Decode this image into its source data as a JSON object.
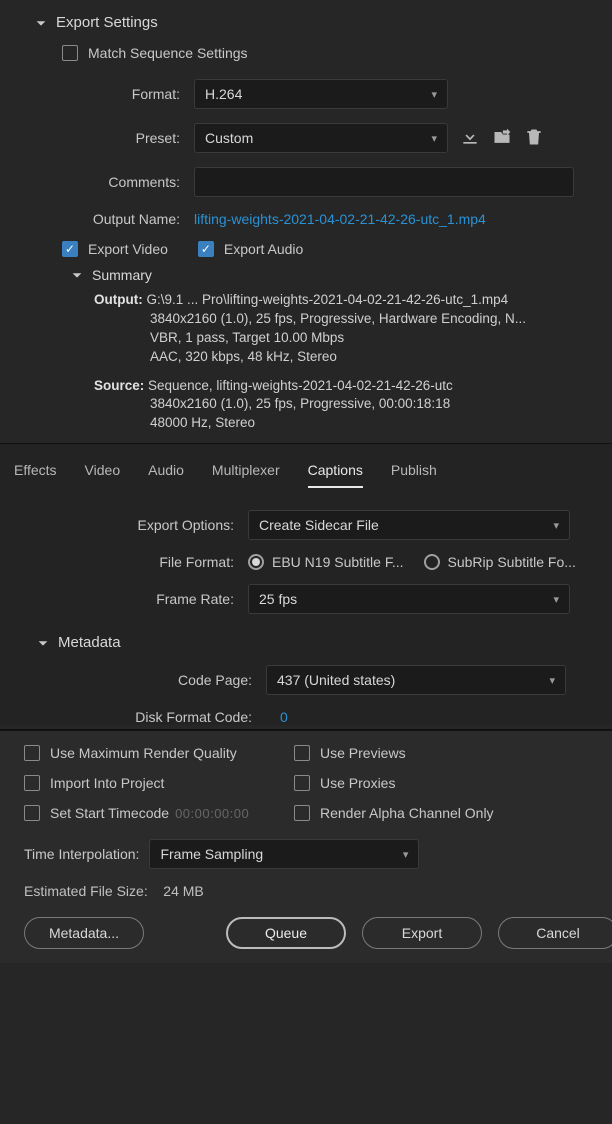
{
  "sections": {
    "export_settings": "Export Settings",
    "summary": "Summary",
    "metadata_section": "Metadata"
  },
  "checkboxes": {
    "match_sequence": "Match Sequence Settings",
    "export_video": "Export Video",
    "export_audio": "Export Audio",
    "use_max_render": "Use Maximum Render Quality",
    "use_previews": "Use Previews",
    "import_project": "Import Into Project",
    "use_proxies": "Use Proxies",
    "set_start_tc": "Set Start Timecode",
    "render_alpha": "Render Alpha Channel Only"
  },
  "labels": {
    "format": "Format:",
    "preset": "Preset:",
    "comments": "Comments:",
    "output_name": "Output Name:",
    "export_options": "Export Options:",
    "file_format": "File Format:",
    "frame_rate": "Frame Rate:",
    "code_page": "Code Page:",
    "disk_format_code": "Disk Format Code:",
    "time_interpolation": "Time Interpolation:",
    "estimated_size": "Estimated File Size:"
  },
  "values": {
    "format": "H.264",
    "preset": "Custom",
    "comments": "",
    "output_name": "lifting-weights-2021-04-02-21-42-26-utc_1.mp4",
    "export_options": "Create Sidecar File",
    "file_format_opt1": "EBU N19 Subtitle F...",
    "file_format_opt2": "SubRip Subtitle Fo...",
    "frame_rate": "25 fps",
    "code_page": "437 (United states)",
    "disk_format_code": "0",
    "time_interpolation": "Frame Sampling",
    "start_timecode": "00:00:00:00",
    "estimated_size_value": "24 MB"
  },
  "summary": {
    "output_label": "Output:",
    "output_line1": "G:\\9.1 ... Pro\\lifting-weights-2021-04-02-21-42-26-utc_1.mp4",
    "output_line2": "3840x2160 (1.0), 25 fps, Progressive, Hardware Encoding, N...",
    "output_line3": "VBR, 1 pass, Target 10.00 Mbps",
    "output_line4": "AAC, 320 kbps, 48 kHz, Stereo",
    "source_label": "Source:",
    "source_line1": "Sequence, lifting-weights-2021-04-02-21-42-26-utc",
    "source_line2": "3840x2160 (1.0), 25 fps, Progressive, 00:00:18:18",
    "source_line3": "48000 Hz, Stereo"
  },
  "tabs": [
    "Effects",
    "Video",
    "Audio",
    "Multiplexer",
    "Captions",
    "Publish"
  ],
  "buttons": {
    "metadata": "Metadata...",
    "queue": "Queue",
    "export": "Export",
    "cancel": "Cancel"
  }
}
